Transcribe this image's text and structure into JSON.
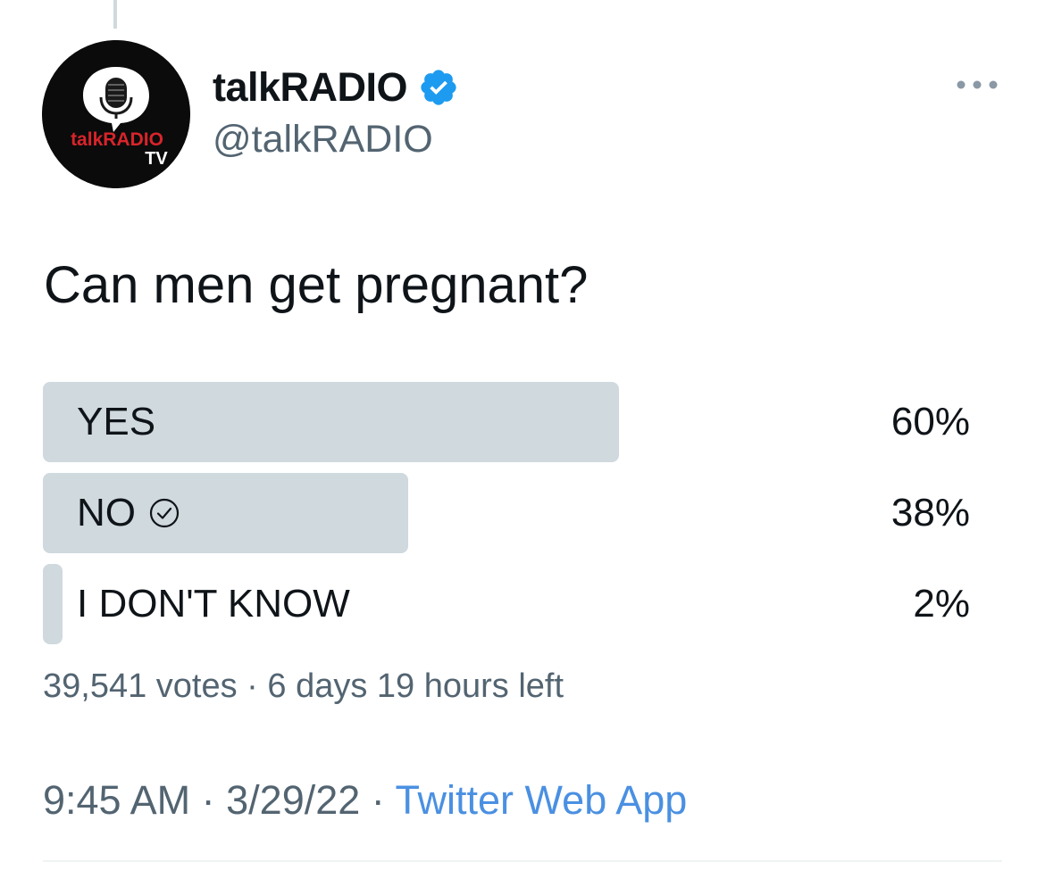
{
  "tweet": {
    "display_name": "talkRADIO",
    "handle": "@talkRADIO",
    "verified": true,
    "avatar": {
      "icon": "microphone-speech-bubble-logo",
      "logo_text_main": "talkRADIO",
      "logo_text_sub": "TV"
    },
    "more_icon": "ellipsis-icon",
    "text": "Can men get pregnant?",
    "poll": {
      "options": [
        {
          "label": "YES",
          "percent_text": "60%",
          "fill": 0.62,
          "winner": false,
          "checked": false
        },
        {
          "label": "NO",
          "percent_text": "38%",
          "fill": 0.393,
          "winner": false,
          "checked": true
        },
        {
          "label": "I DON'T KNOW",
          "percent_text": "2%",
          "fill": 0.021,
          "winner": false,
          "checked": false
        }
      ],
      "votes": "39,541 votes",
      "separator": "·",
      "time_left": "6 days 19 hours left"
    },
    "time": "9:45 AM",
    "date": "3/29/22",
    "source": "Twitter Web App"
  },
  "colors": {
    "accent": "#1d9bf0",
    "link": "#4a90e2",
    "poll_bar": "#cfd9de",
    "secondary_text": "#536471",
    "primary_text": "#0f1419",
    "logo_red": "#d8242a"
  }
}
